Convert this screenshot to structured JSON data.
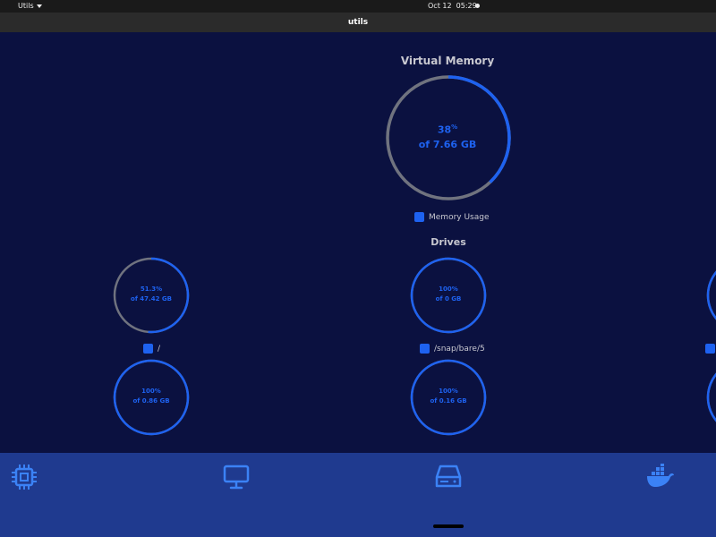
{
  "topbar": {
    "app_menu": "Utils",
    "date": "Oct 12",
    "time": "05:29"
  },
  "window": {
    "title": "utils"
  },
  "virtual_memory": {
    "title": "Virtual Memory",
    "percent": 38,
    "percent_label": "38",
    "percent_unit": "%",
    "total_label": "of 7.66 GB",
    "legend": "Memory Usage"
  },
  "drives": {
    "title": "Drives",
    "items": [
      {
        "percent": 51.3,
        "percent_label": "51.3",
        "total_label": "of 47.42 GB",
        "mount": "/"
      },
      {
        "percent": 100,
        "percent_label": "100",
        "total_label": "of 0 GB",
        "mount": "/snap/bare/5"
      },
      {
        "percent": 100,
        "percent_label": "100",
        "total_label": "of 0.86 GB",
        "mount": ""
      },
      {
        "percent": 100,
        "percent_label": "100",
        "total_label": "of 0.16 GB",
        "mount": ""
      }
    ],
    "percent_unit": "%"
  },
  "colors": {
    "ring_used": "#1e62f0",
    "ring_free": "#70737f",
    "background": "#0b1140",
    "nav": "#1f3a8f",
    "nav_icon": "#3b82f6"
  },
  "nav": [
    {
      "icon": "cpu-icon"
    },
    {
      "icon": "monitor-icon"
    },
    {
      "icon": "hard-drive-icon"
    },
    {
      "icon": "docker-icon"
    }
  ]
}
